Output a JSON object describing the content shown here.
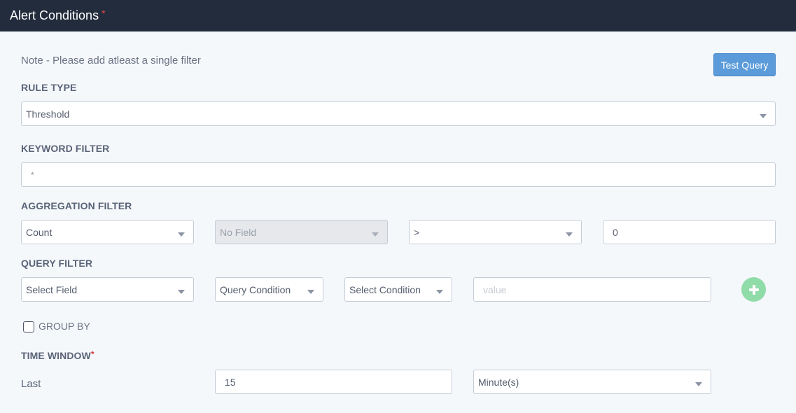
{
  "header": {
    "title": "Alert Conditions",
    "required_mark": "*"
  },
  "note": "Note - Please add atleast a single filter",
  "test_query_label": "Test Query",
  "rule_type": {
    "label": "RULE TYPE",
    "value": "Threshold"
  },
  "keyword_filter": {
    "label": "KEYWORD FILTER",
    "value": "*"
  },
  "aggregation_filter": {
    "label": "AGGREGATION FILTER",
    "function": "Count",
    "field": "No Field",
    "operator": ">",
    "value": "0"
  },
  "query_filter": {
    "label": "QUERY FILTER",
    "field": "Select Field",
    "query_condition": "Query Condition",
    "select_condition": "Select Condition",
    "value_placeholder": "value"
  },
  "group_by": {
    "label": "GROUP BY",
    "checked": false
  },
  "time_window": {
    "label": "TIME WINDOW",
    "required_mark": "*",
    "last_label": "Last",
    "amount": "15",
    "unit": "Minute(s)"
  },
  "colors": {
    "header_bg": "#232c3d",
    "accent": "#5b9bd9",
    "add_button": "#8fdca8",
    "required": "#e04646"
  },
  "icons": {
    "add": "plus-circle-icon",
    "dropdown": "chevron-down-icon"
  }
}
